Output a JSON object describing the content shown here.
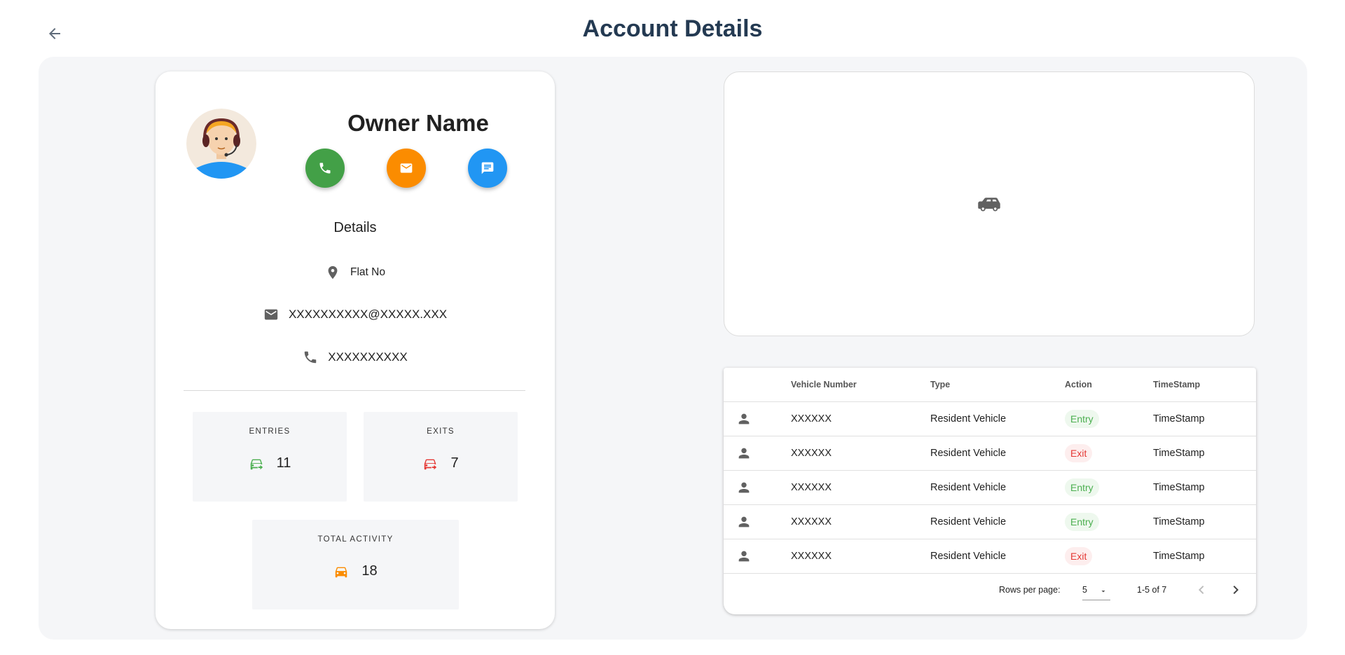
{
  "header": {
    "title": "Account Details"
  },
  "profile": {
    "owner_name": "Owner Name",
    "details_heading": "Details",
    "flat": "Flat No",
    "email": "XXXXXXXXXX@XXXXX.XXX",
    "phone": "XXXXXXXXXX"
  },
  "stats": {
    "entries": {
      "label": "ENTRIES",
      "value": "11"
    },
    "exits": {
      "label": "EXITS",
      "value": "7"
    },
    "total": {
      "label": "TOTAL ACTIVITY",
      "value": "18"
    }
  },
  "colors": {
    "call": "#43a047",
    "email": "#fb8c00",
    "message": "#2196f3",
    "entry": "#4caf50",
    "exit": "#e53935",
    "total": "#fb8c00"
  },
  "icons": {
    "back": "arrow-left-icon",
    "call": "phone-icon",
    "email": "mail-icon",
    "message": "message-icon",
    "location": "location-pin-icon",
    "car": "car-icon",
    "person": "person-icon"
  },
  "table": {
    "headers": {
      "vehicle_number": "Vehicle Number",
      "type": "Type",
      "action": "Action",
      "timestamp": "TimeStamp"
    },
    "rows": [
      {
        "vehicle_number": "XXXXXX",
        "type": "Resident Vehicle",
        "action": "Entry",
        "timestamp": "TimeStamp"
      },
      {
        "vehicle_number": "XXXXXX",
        "type": "Resident Vehicle",
        "action": "Exit",
        "timestamp": "TimeStamp"
      },
      {
        "vehicle_number": "XXXXXX",
        "type": "Resident Vehicle",
        "action": "Entry",
        "timestamp": "TimeStamp"
      },
      {
        "vehicle_number": "XXXXXX",
        "type": "Resident Vehicle",
        "action": "Entry",
        "timestamp": "TimeStamp"
      },
      {
        "vehicle_number": "XXXXXX",
        "type": "Resident Vehicle",
        "action": "Exit",
        "timestamp": "TimeStamp"
      }
    ],
    "pagination": {
      "rows_per_page_label": "Rows per page:",
      "rows_per_page": "5",
      "range": "1-5 of 7"
    }
  }
}
